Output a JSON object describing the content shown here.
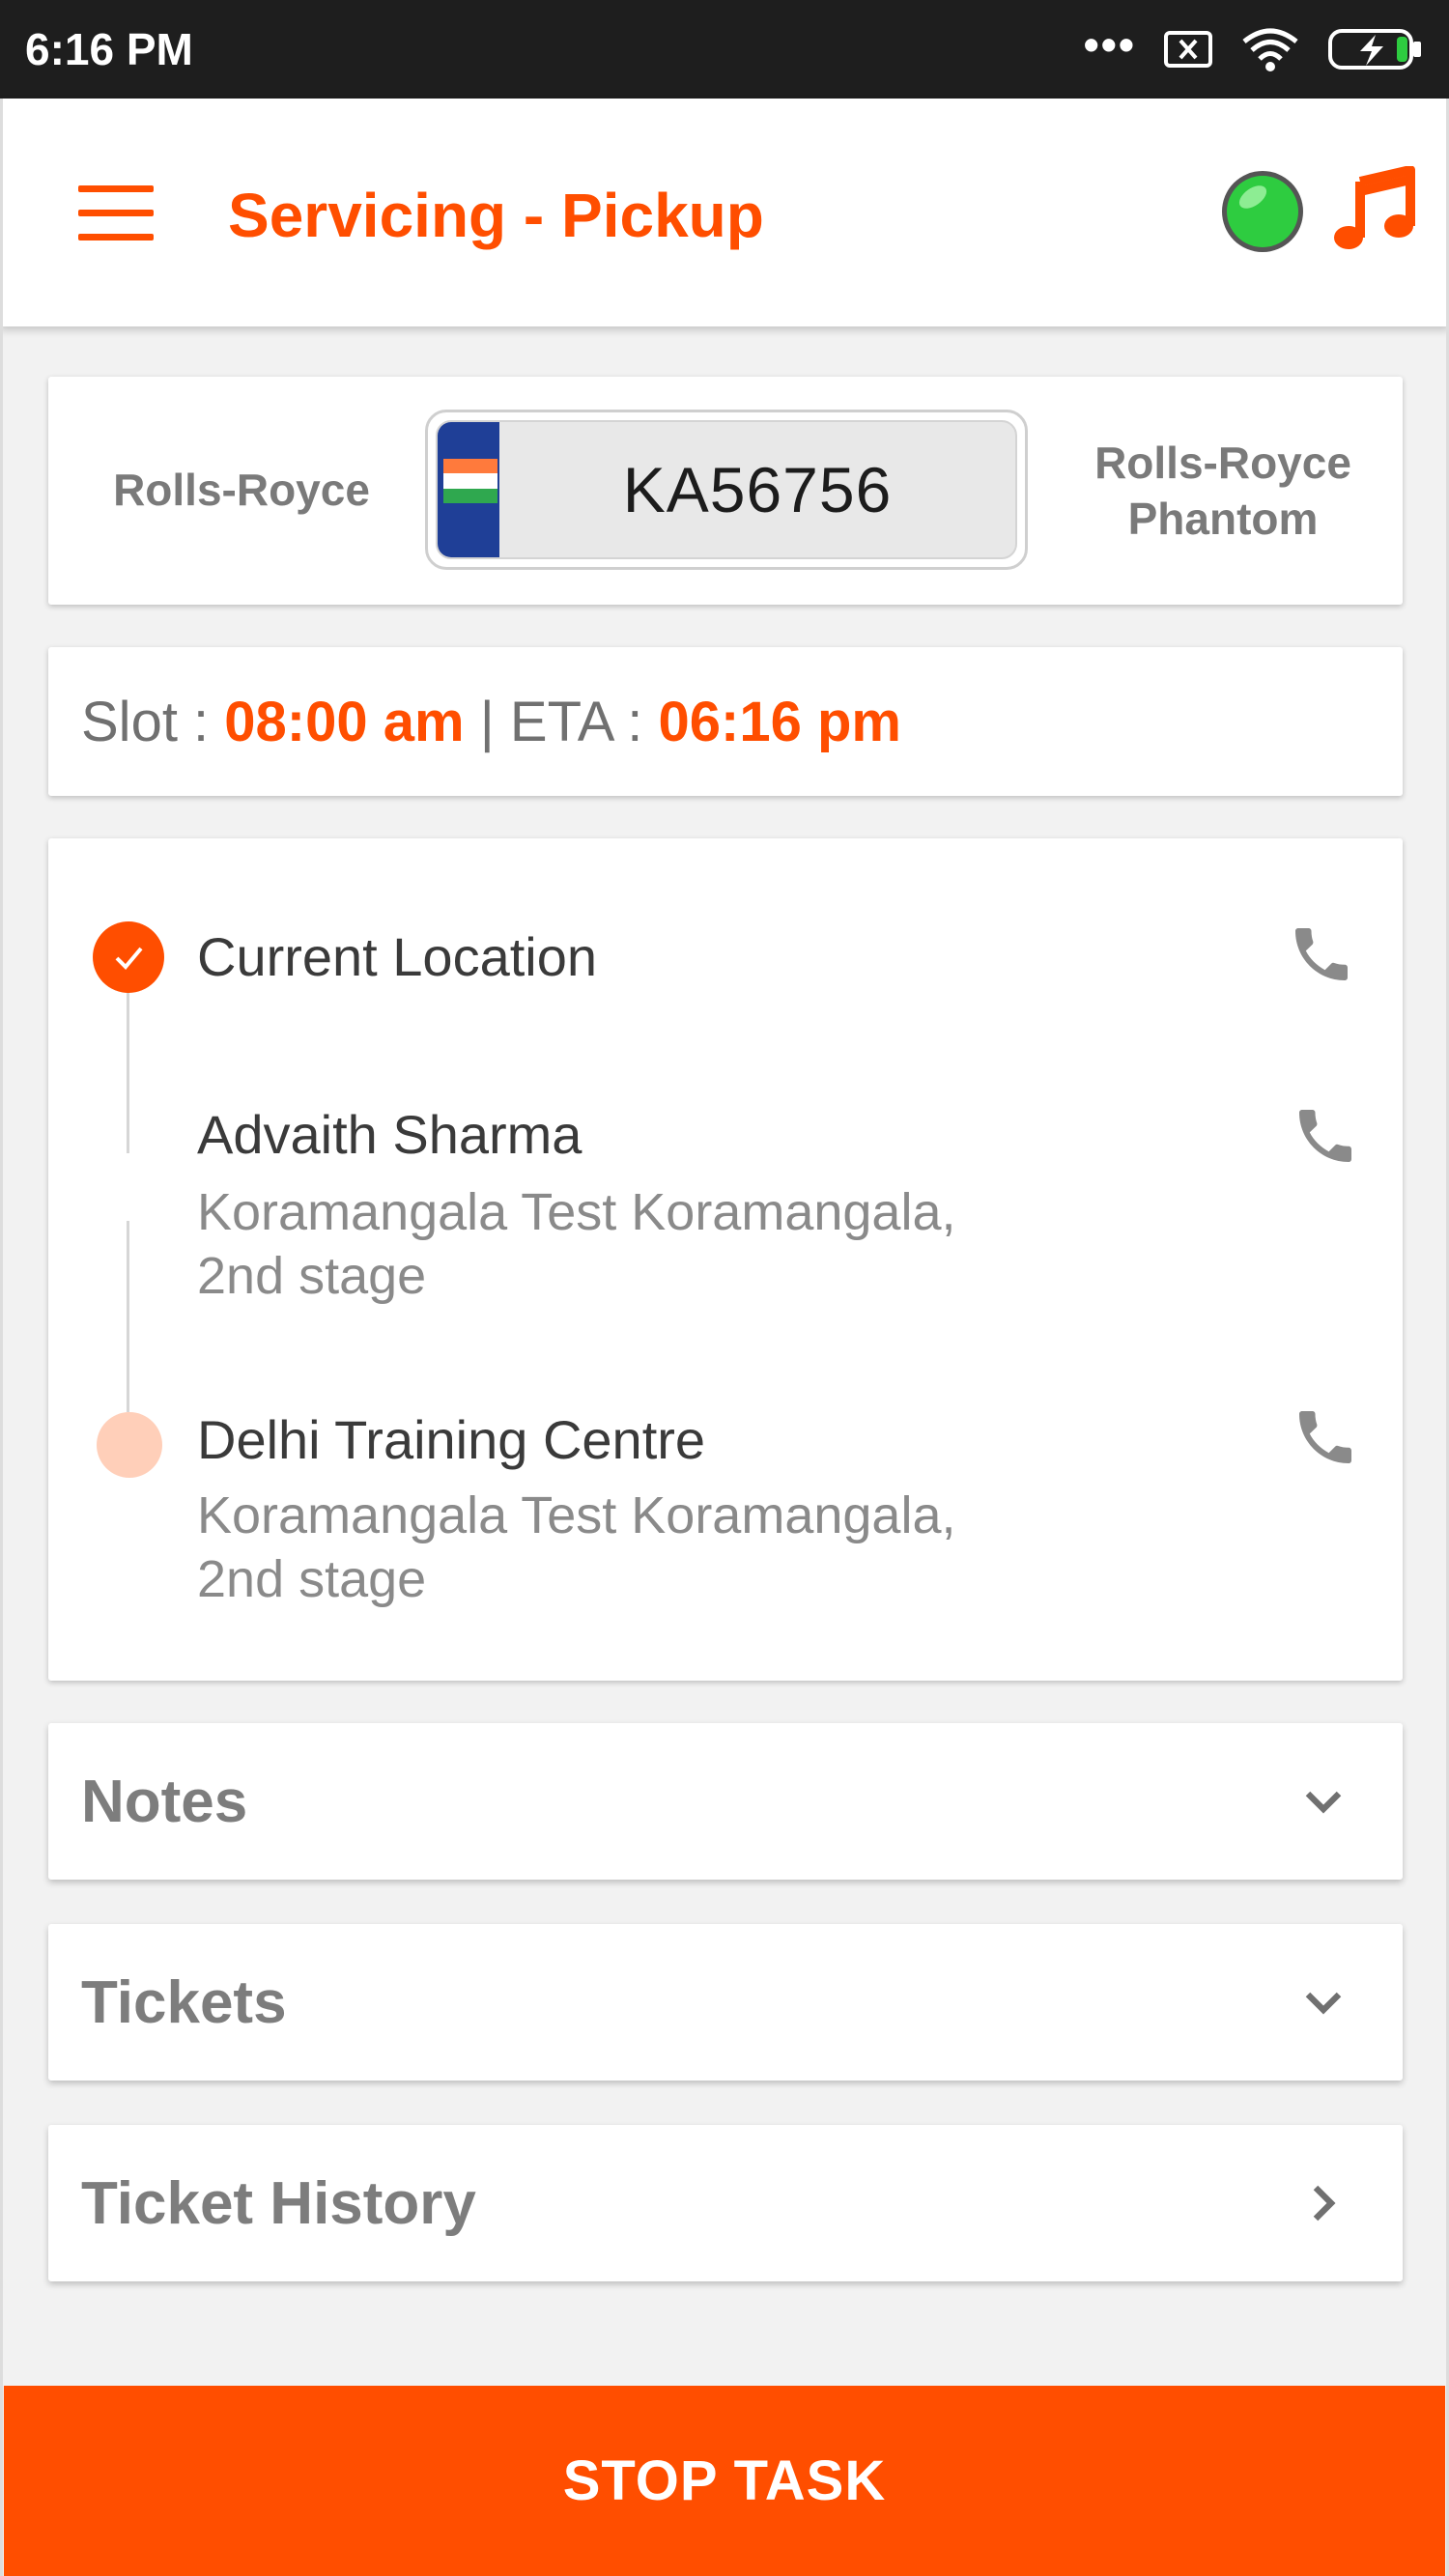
{
  "status_bar": {
    "time": "6:16 PM",
    "icons": [
      "more-dots-icon",
      "sim-x-icon",
      "wifi-icon",
      "battery-charging-icon"
    ]
  },
  "header": {
    "title": "Servicing - Pickup",
    "menu_icon": "hamburger-menu-icon",
    "status_indicator": "online-status-icon",
    "status_color": "#2ecc40",
    "music_icon": "music-note-icon"
  },
  "vehicle": {
    "make": "Rolls-Royce",
    "plate": "KA56756",
    "model_line1": "Rolls-Royce",
    "model_line2": "Phantom"
  },
  "timing": {
    "slot_label": "Slot : ",
    "slot_value": "08:00 am",
    "separator": " | ETA : ",
    "eta_value": "06:16 pm"
  },
  "route": {
    "stops": [
      {
        "name": "Current Location",
        "address_line1": "",
        "address_line2": ""
      },
      {
        "name": "Advaith Sharma",
        "address_line1": "Koramangala Test Koramangala,",
        "address_line2": "2nd stage"
      },
      {
        "name": "Delhi Training Centre",
        "address_line1": "Koramangala Test Koramangala,",
        "address_line2": "2nd stage"
      }
    ]
  },
  "sections": {
    "notes": "Notes",
    "tickets": "Tickets",
    "ticket_history": "Ticket History"
  },
  "actions": {
    "stop_task": "STOP TASK"
  },
  "colors": {
    "accent": "#ff4e00",
    "accent_light": "#ffcfb9",
    "plate_blue": "#1f3f97"
  }
}
